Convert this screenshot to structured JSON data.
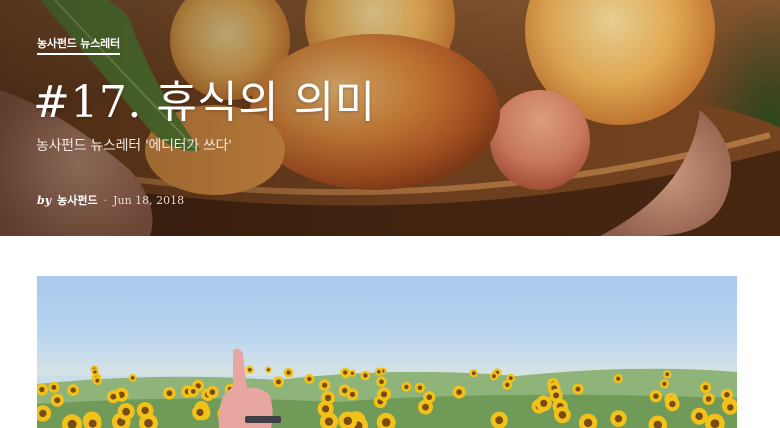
{
  "hero": {
    "category": "농사펀드 뉴스레터",
    "title": "#17. 휴식의 의미",
    "subtitle": "농사펀드 뉴스레터 '에디터가 쓰다'",
    "byline": {
      "prefix": "by",
      "author": "농사펀드",
      "separator": "·",
      "date": "Jun 18, 2018"
    }
  },
  "colors": {
    "hero_text": "#ffffff",
    "page_background": "#ffffff",
    "peach": "#f1b04a",
    "sky": "#a9c9ee",
    "sunflower": "#f2c21b"
  },
  "images": {
    "hero": "peaches-in-bowl-photo",
    "article": "sunflower-field-photo"
  }
}
